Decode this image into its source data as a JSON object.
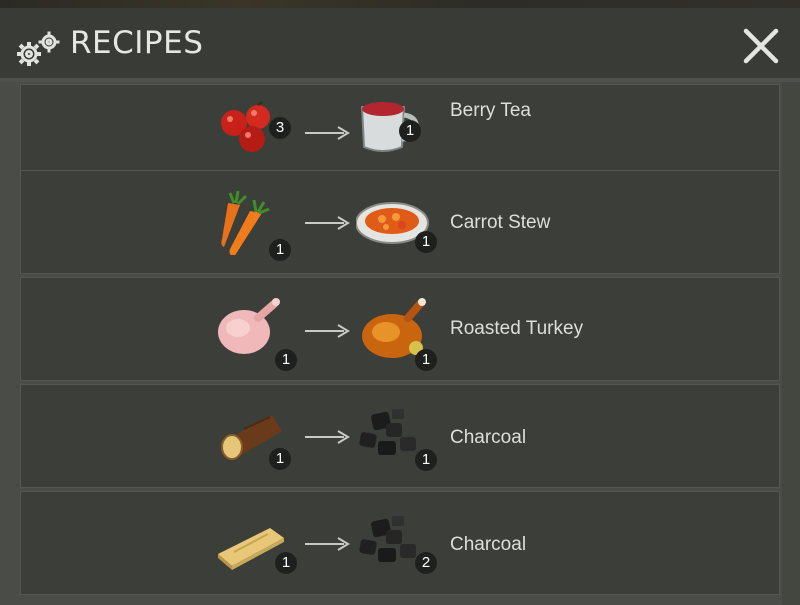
{
  "header": {
    "title": "RECIPES",
    "icons": {
      "title": "gears-icon",
      "close": "close-x-icon"
    }
  },
  "recipes": [
    {
      "ingredient": {
        "item": "berries",
        "count": "3"
      },
      "product": {
        "item": "berry-tea-mug",
        "count": "1"
      },
      "name": "Berry Tea"
    },
    {
      "ingredient": {
        "item": "carrots",
        "count": "1"
      },
      "product": {
        "item": "carrot-stew-bowl",
        "count": "1"
      },
      "name": "Carrot Stew"
    },
    {
      "ingredient": {
        "item": "raw-turkey",
        "count": "1"
      },
      "product": {
        "item": "roasted-turkey",
        "count": "1"
      },
      "name": "Roasted Turkey"
    },
    {
      "ingredient": {
        "item": "log",
        "count": "1"
      },
      "product": {
        "item": "charcoal",
        "count": "1"
      },
      "name": "Charcoal"
    },
    {
      "ingredient": {
        "item": "plank",
        "count": "1"
      },
      "product": {
        "item": "charcoal",
        "count": "2"
      },
      "name": "Charcoal"
    }
  ],
  "colors": {
    "header_bg": "#383b36",
    "row_bg": "#3b3e39",
    "frame_bg": "#4a4d47",
    "text": "#e6e6e2",
    "badge_bg": "#1e201d"
  }
}
